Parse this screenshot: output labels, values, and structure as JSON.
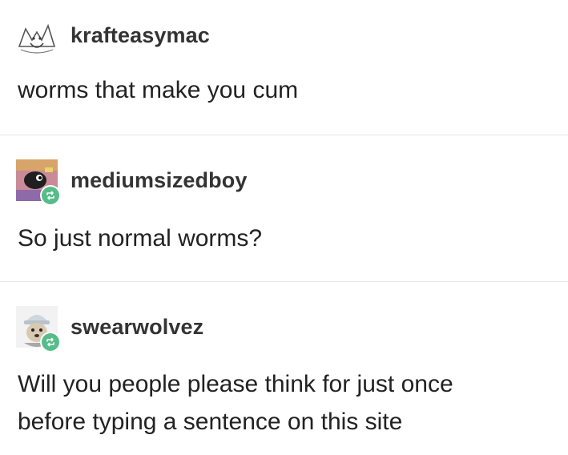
{
  "posts": [
    {
      "username": "krafteasymac",
      "body": [
        "worms that make you cum"
      ],
      "reblog": false,
      "avatar_icon": "bat-sketch-avatar-icon"
    },
    {
      "username": "mediumsizedboy",
      "body": [
        "So just normal worms?"
      ],
      "reblog": true,
      "avatar_icon": "pixel-character-avatar-icon"
    },
    {
      "username": "swearwolvez",
      "body": [
        "Will you people please think for just once",
        "before typing a sentence on this site"
      ],
      "reblog": true,
      "avatar_icon": "dog-in-hat-avatar-icon"
    }
  ],
  "colors": {
    "reblog_badge": "#56bc8a",
    "divider": "#e6e6e6",
    "text": "#222222"
  }
}
